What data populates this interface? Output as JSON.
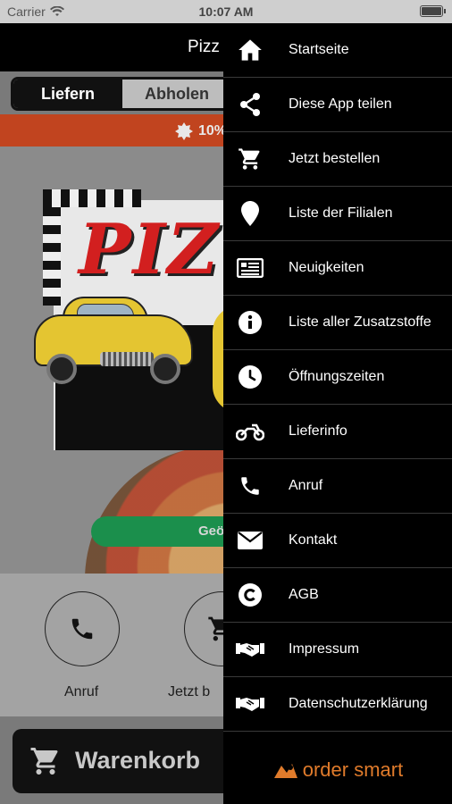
{
  "status": {
    "carrier": "Carrier",
    "time": "10:07 AM"
  },
  "app": {
    "title": "Pizz",
    "segments": [
      "Liefern",
      "Abholen"
    ],
    "promo": "10%",
    "logo_text": "PIZ",
    "green_button": "Geö",
    "actions": [
      "Anruf",
      "Jetzt b"
    ],
    "cart_label": "Warenkorb"
  },
  "menu": {
    "items": [
      {
        "label": "Startseite",
        "icon": "home-icon"
      },
      {
        "label": "Diese App teilen",
        "icon": "share-icon"
      },
      {
        "label": "Jetzt bestellen",
        "icon": "cart-icon"
      },
      {
        "label": "Liste der Filialen",
        "icon": "location-pin-icon"
      },
      {
        "label": "Neuigkeiten",
        "icon": "news-icon"
      },
      {
        "label": "Liste aller Zusatzstoffe",
        "icon": "info-icon"
      },
      {
        "label": "Öffnungszeiten",
        "icon": "clock-icon"
      },
      {
        "label": "Lieferinfo",
        "icon": "motorcycle-icon"
      },
      {
        "label": "Anruf",
        "icon": "phone-icon"
      },
      {
        "label": "Kontakt",
        "icon": "envelope-icon"
      },
      {
        "label": "AGB",
        "icon": "copyright-icon"
      },
      {
        "label": "Impressum",
        "icon": "handshake-icon"
      },
      {
        "label": "Datenschutzerklärung",
        "icon": "handshake-icon"
      }
    ],
    "footer_brand": "order smart"
  },
  "colors": {
    "accent": "#e07b2b",
    "promo": "#c1441f",
    "green": "#1b8f4c"
  }
}
